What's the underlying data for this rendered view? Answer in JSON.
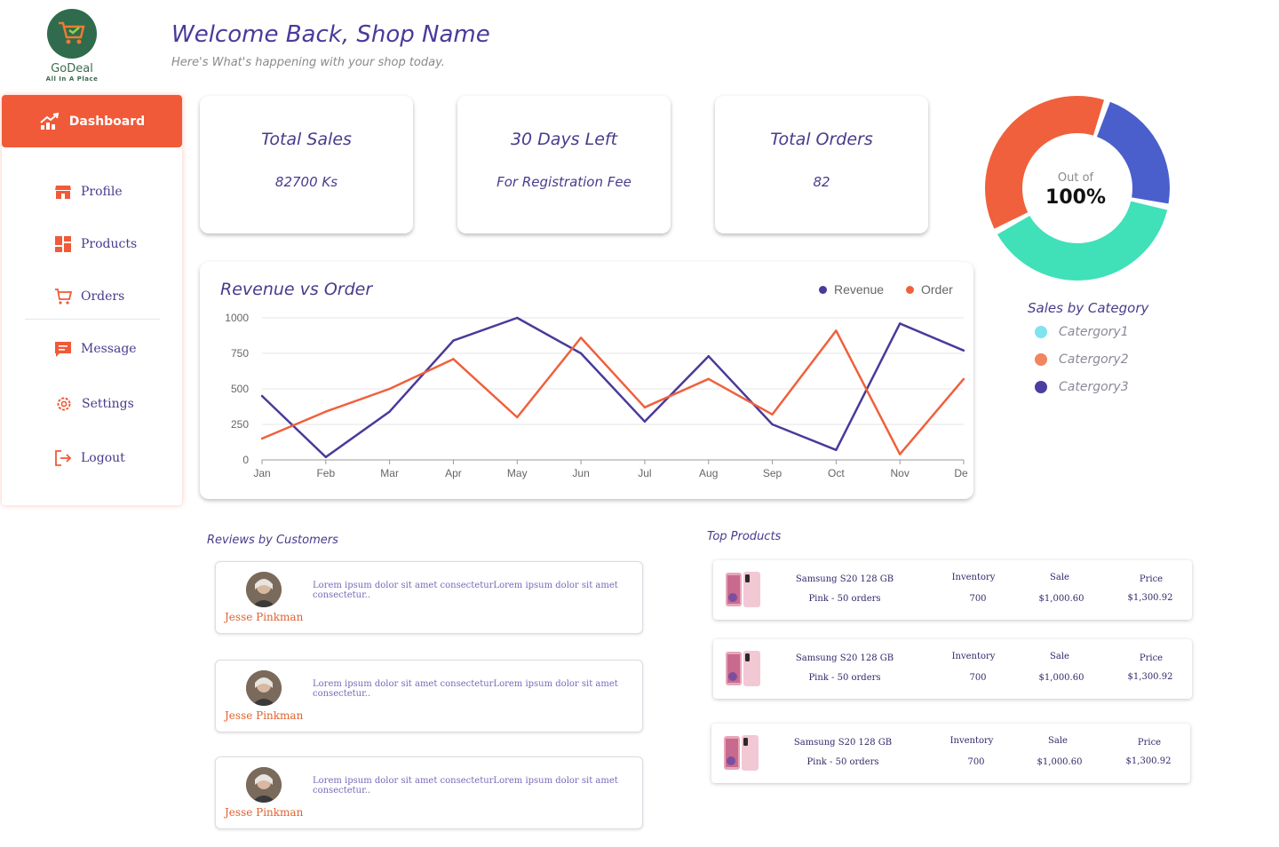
{
  "logo": {
    "name": "GoDeal",
    "tagline": "All In A Place"
  },
  "header": {
    "title": "Welcome Back, Shop Name",
    "subtitle": "Here's  What's happening with your shop today."
  },
  "sidebar": {
    "active": {
      "label": "Dashboard",
      "icon": "trending-up-icon"
    },
    "items": [
      {
        "label": "Profile",
        "icon": "store-icon"
      },
      {
        "label": "Products",
        "icon": "grid-icon"
      },
      {
        "label": "Orders",
        "icon": "cart-icon"
      },
      {
        "label": "Message",
        "icon": "message-icon"
      },
      {
        "label": "Settings",
        "icon": "gear-icon"
      },
      {
        "label": "Logout",
        "icon": "logout-icon"
      }
    ]
  },
  "stats": [
    {
      "title": "Total Sales",
      "value": "82700 Ks"
    },
    {
      "title": "30 Days Left",
      "value": "For Registration Fee"
    },
    {
      "title": "Total Orders",
      "value": "82"
    }
  ],
  "donut": {
    "label_top": "Out of",
    "label_main": "100%",
    "segments": [
      {
        "color": "#f0603c",
        "fraction": 0.38
      },
      {
        "color": "#4a5fcc",
        "fraction": 0.23
      },
      {
        "color": "#40e0b8",
        "fraction": 0.39
      }
    ]
  },
  "categories": {
    "title": "Sales by Category",
    "items": [
      {
        "label": "Catergory1",
        "color": "#7fe3f0"
      },
      {
        "label": "Catergory2",
        "color": "#f0855e"
      },
      {
        "label": "Catergory3",
        "color": "#4a3fa0"
      }
    ]
  },
  "chart": {
    "title": "Revenue vs Order"
  },
  "chart_data": {
    "type": "line",
    "title": "Revenue vs Order",
    "x": [
      "Jan",
      "Feb",
      "Mar",
      "Apr",
      "May",
      "Jun",
      "Jul",
      "Aug",
      "Sep",
      "Oct",
      "Nov",
      "Dec"
    ],
    "ylim": [
      0,
      1000
    ],
    "yticks": [
      0,
      250,
      500,
      750,
      1000
    ],
    "grid": true,
    "legend": "top-right",
    "series": [
      {
        "name": "Revenue",
        "color": "#4a3a9a",
        "values": [
          450,
          20,
          340,
          840,
          1000,
          750,
          270,
          730,
          250,
          70,
          960,
          770
        ]
      },
      {
        "name": "Order",
        "color": "#f0603c",
        "values": [
          150,
          340,
          500,
          710,
          300,
          860,
          370,
          570,
          320,
          910,
          40,
          570
        ]
      }
    ]
  },
  "reviews": {
    "title": "Reviews by Customers",
    "items": [
      {
        "name": "Jesse Pinkman",
        "text": "Lorem ipsum dolor sit amet consecteturLorem ipsum dolor sit amet consectetur.."
      },
      {
        "name": "Jesse Pinkman",
        "text": "Lorem ipsum dolor sit amet consecteturLorem ipsum dolor sit amet consectetur.."
      },
      {
        "name": "Jesse Pinkman",
        "text": "Lorem ipsum dolor sit amet consecteturLorem ipsum dolor sit amet consectetur.."
      }
    ]
  },
  "products": {
    "title": "Top Products",
    "items": [
      {
        "name": "Samsung S20 128 GB",
        "detail": "Pink - 50 orders",
        "inventory_label": "Inventory",
        "inventory": "700",
        "sale_label": "Sale",
        "sale": "$1,000.60",
        "price_label": "Price",
        "price": "$1,300.92"
      },
      {
        "name": "Samsung S20 128 GB",
        "detail": "Pink - 50 orders",
        "inventory_label": "Inventory",
        "inventory": "700",
        "sale_label": "Sale",
        "sale": "$1,000.60",
        "price_label": "Price",
        "price": "$1,300.92"
      },
      {
        "name": "Samsung S20 128 GB",
        "detail": "Pink - 50 orders",
        "inventory_label": "Inventory",
        "inventory": "700",
        "sale_label": "Sale",
        "sale": "$1,000.60",
        "price_label": "Price",
        "price": "$1,300.92"
      }
    ]
  }
}
